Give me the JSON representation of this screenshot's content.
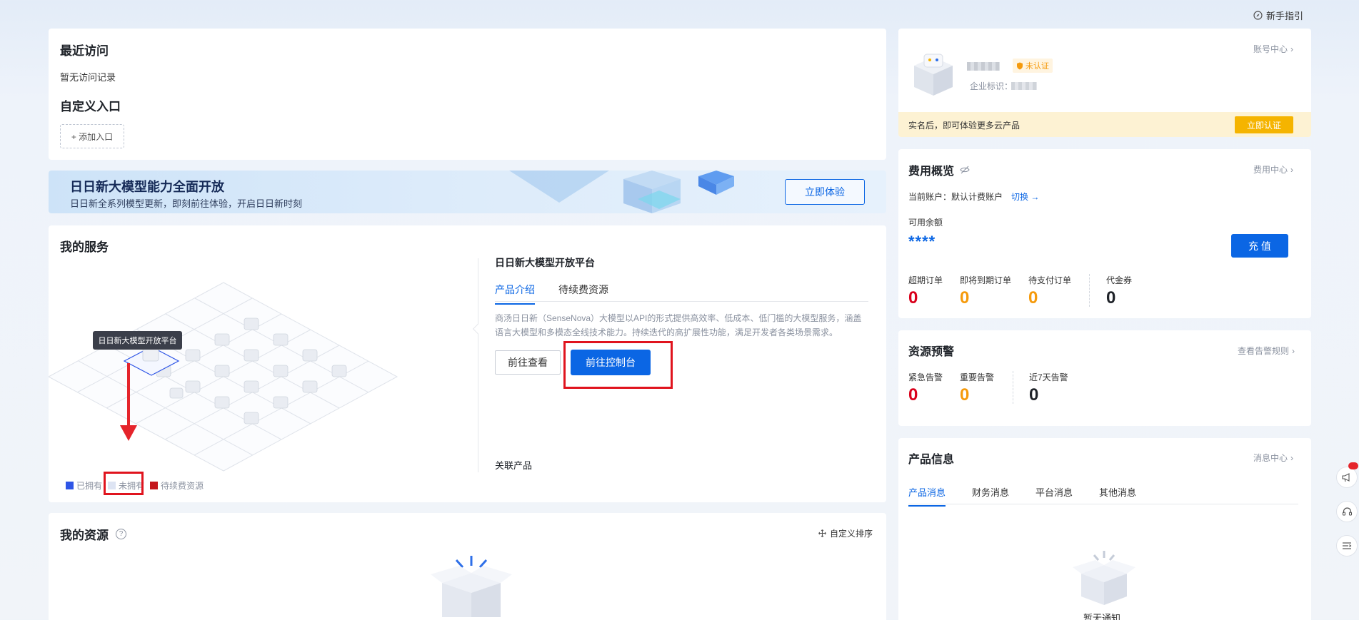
{
  "topbar": {
    "guide_label": "新手指引"
  },
  "recent": {
    "title": "最近访问",
    "empty_text": "暂无访问记录",
    "custom_title": "自定义入口",
    "add_label": "+ 添加入口"
  },
  "banner": {
    "title": "日日新大模型能力全面开放",
    "subtitle": "日日新全系列模型更新，即刻前往体验，开启日日新时刻",
    "button_label": "立即体验"
  },
  "services": {
    "title": "我的服务",
    "tooltip": "日日新大模型开放平台",
    "legend": [
      {
        "label": "已拥有",
        "color": "#2e55e6"
      },
      {
        "label": "未拥有",
        "color": "#dde4f3"
      },
      {
        "label": "待续费资源",
        "color": "#c4161c"
      }
    ],
    "panel": {
      "product_title": "日日新大模型开放平台",
      "tabs": [
        "产品介绍",
        "待续费资源"
      ],
      "description": "商汤日日新（SenseNova）大模型以API的形式提供高效率、低成本、低门槛的大模型服务，涵盖语言大模型和多模态全线技术能力。持续迭代的高扩展性功能，满足开发者各类场景需求。",
      "btn_view": "前往查看",
      "btn_console": "前往控制台",
      "related_title": "关联产品"
    }
  },
  "resources": {
    "title": "我的资源",
    "sort_label": "自定义排序"
  },
  "account": {
    "link_label": "账号中心",
    "badge_label": "未认证",
    "org_id_label": "企业标识：",
    "notice_text": "实名后，即可体验更多云产品",
    "verify_label": "立即认证"
  },
  "billing": {
    "title": "费用概览",
    "link_label": "费用中心",
    "current_account": "当前账户：默认计费账户",
    "switch_label": "切换",
    "balance_label": "可用余额",
    "balance_value": "****",
    "recharge_label": "充 值",
    "stats": [
      {
        "label": "超期订单",
        "value": "0"
      },
      {
        "label": "即将到期订单",
        "value": "0"
      },
      {
        "label": "待支付订单",
        "value": "0"
      },
      {
        "label": "代金券",
        "value": "0"
      }
    ]
  },
  "alerts": {
    "title": "资源预警",
    "link_label": "查看告警规则",
    "stats": [
      {
        "label": "紧急告警",
        "value": "0"
      },
      {
        "label": "重要告警",
        "value": "0"
      },
      {
        "label": "近7天告警",
        "value": "0"
      }
    ]
  },
  "messages": {
    "title": "产品信息",
    "link_label": "消息中心",
    "tabs": [
      "产品消息",
      "财务消息",
      "平台消息",
      "其他消息"
    ],
    "empty_text": "暂无通知"
  },
  "colors": {
    "accent": "#0b66e4",
    "danger": "#d9001b",
    "warning": "#f59a0c",
    "highlight": "#e0141e"
  }
}
